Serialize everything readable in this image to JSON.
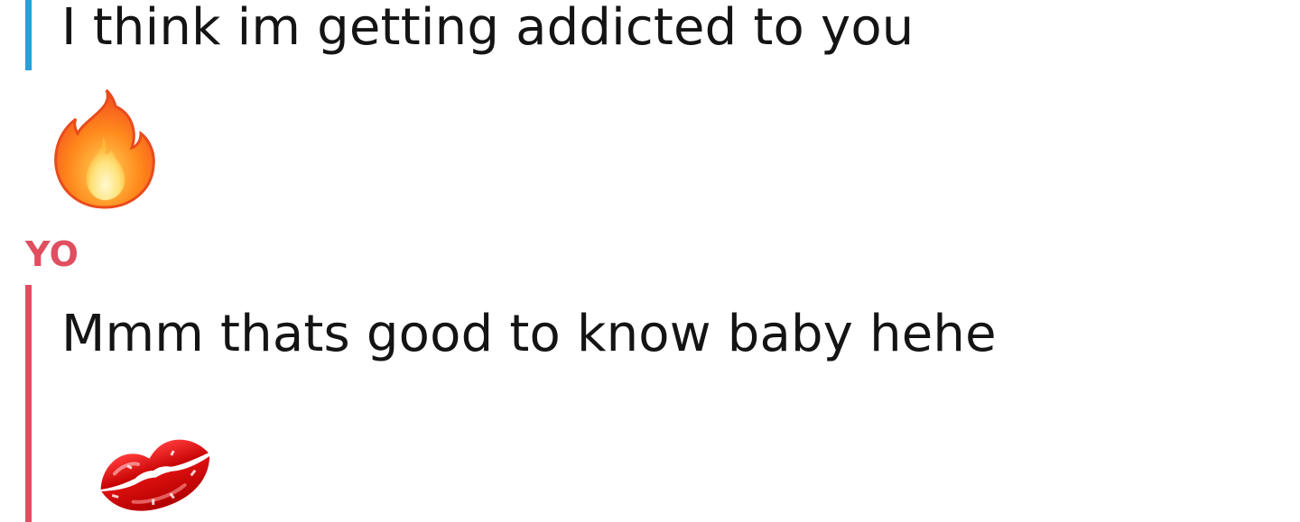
{
  "conversation": {
    "messages": [
      {
        "from": "other",
        "accent": "#2a9fd8",
        "text": "I think im getting addicted to you",
        "emoji": "fire-emoji"
      },
      {
        "from": "me",
        "sender_label": "YO",
        "accent": "#e04e60",
        "text": "Mmm thats good to know baby hehe",
        "emoji": "kiss-mark-emoji"
      }
    ]
  }
}
